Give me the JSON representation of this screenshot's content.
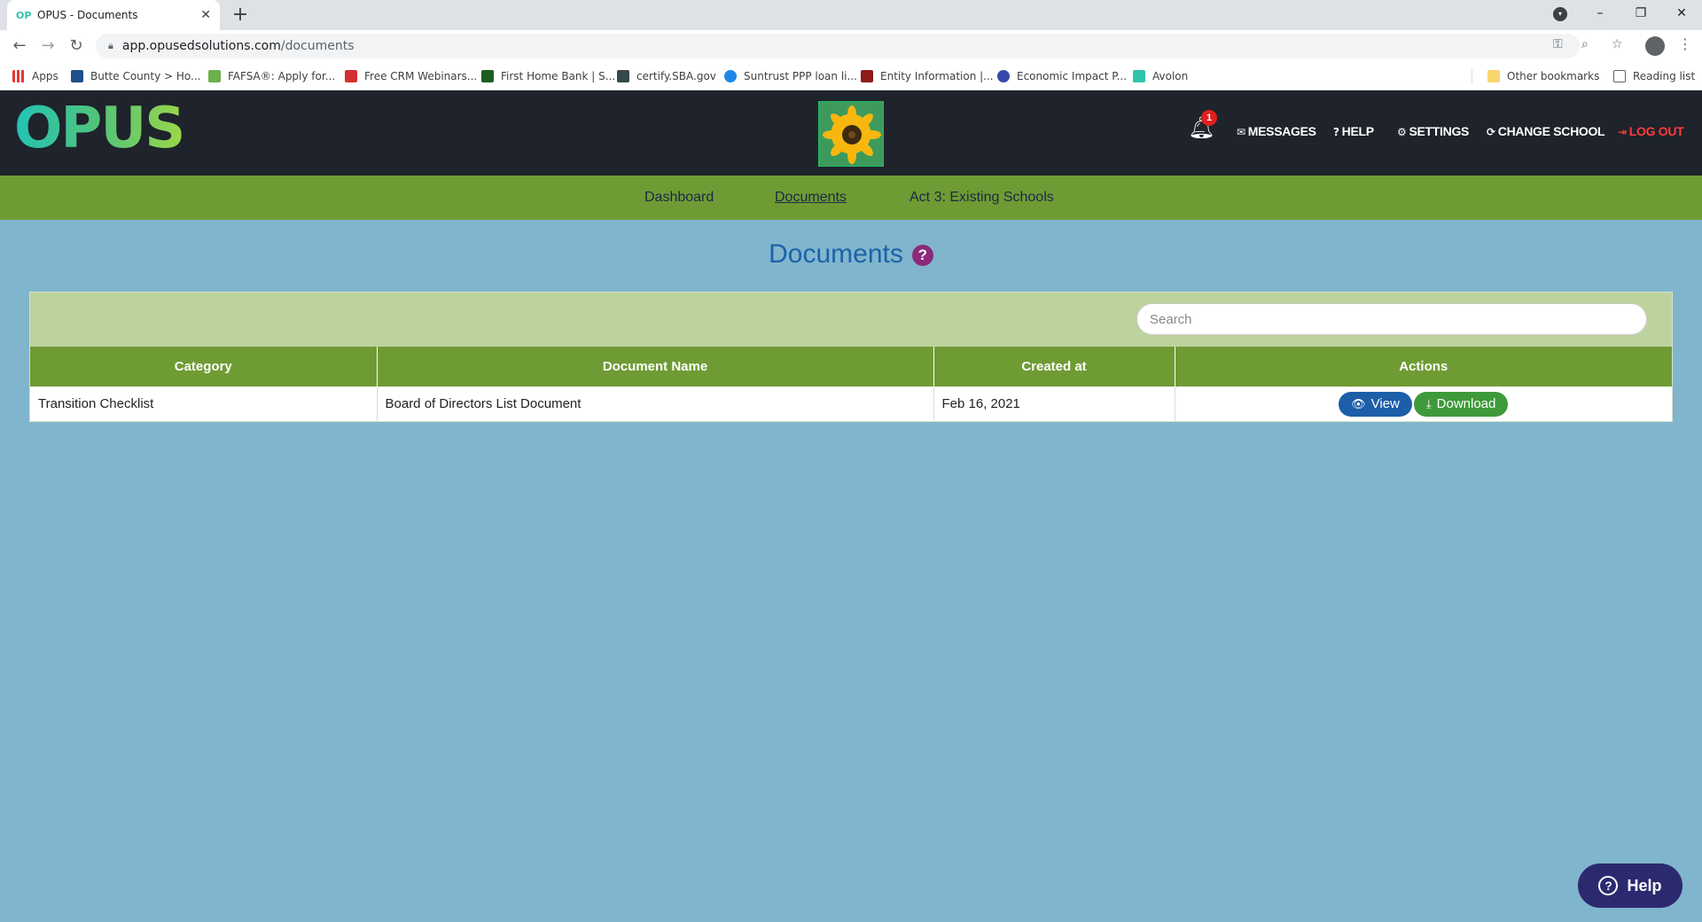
{
  "browser": {
    "tab_title": "OPUS - Documents",
    "tab_close": "✕",
    "new_tab": "+",
    "url_host": "app.opusedsolutions.com",
    "url_path": "/documents",
    "bookmarks": [
      {
        "label": "Apps",
        "color": "#e53935"
      },
      {
        "label": "Butte County > Ho...",
        "color": "#1e4f8a"
      },
      {
        "label": "FAFSA®: Apply for...",
        "color": "#6ab04c"
      },
      {
        "label": "Free CRM Webinars...",
        "color": "#d32f2f"
      },
      {
        "label": "First Home Bank | S...",
        "color": "#1b5e20"
      },
      {
        "label": "certify.SBA.gov",
        "color": "#37474f"
      },
      {
        "label": "Suntrust PPP loan li...",
        "color": "#1e88e5"
      },
      {
        "label": "Entity Information |...",
        "color": "#8d1b1b"
      },
      {
        "label": "Economic Impact P...",
        "color": "#3949ab"
      },
      {
        "label": "Avolon",
        "color": "#2ec4a9"
      }
    ],
    "other_bookmarks": "Other bookmarks",
    "reading_list": "Reading list"
  },
  "header": {
    "logo": "OPUS",
    "notification_count": "1",
    "nav": [
      {
        "label": "MESSAGES",
        "icon": "✉"
      },
      {
        "label": "HELP",
        "icon": "?"
      },
      {
        "label": "SETTINGS",
        "icon": "⚙"
      },
      {
        "label": "CHANGE SCHOOL",
        "icon": "⟳"
      },
      {
        "label": "LOG OUT",
        "icon": "⇥"
      }
    ]
  },
  "subnav": {
    "items": [
      "Dashboard",
      "Documents",
      "Act 3: Existing Schools"
    ],
    "active": "Documents"
  },
  "page": {
    "title": "Documents",
    "help_glyph": "?"
  },
  "documents": {
    "search_placeholder": "Search",
    "columns": [
      "Category",
      "Document Name",
      "Created at",
      "Actions"
    ],
    "rows": [
      {
        "category": "Transition Checklist",
        "name": "Board of Directors List Document",
        "created_at": "Feb 16, 2021",
        "view_label": "View",
        "download_label": "Download"
      }
    ]
  },
  "help_fab": {
    "label": "Help"
  },
  "colors": {
    "page_bg": "#80b5cd",
    "header_bg": "#1f232b",
    "nav_green": "#6f9b34",
    "toolbar_green": "#bdd39e",
    "title_blue": "#1a63a8",
    "view_blue": "#1c5ea8",
    "download_green": "#3e9a3a",
    "logout_red": "#ff3b3b"
  }
}
